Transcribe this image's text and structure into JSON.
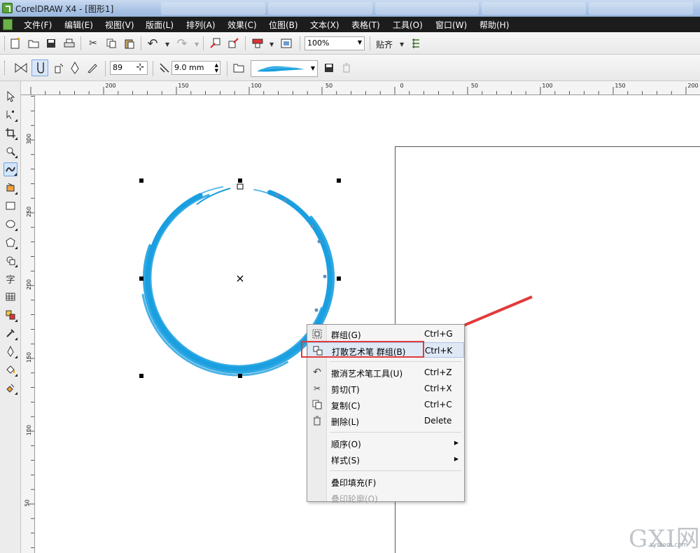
{
  "window": {
    "title": "CorelDRAW X4 - [图形1]"
  },
  "menubar": {
    "items": [
      "文件(F)",
      "编辑(E)",
      "视图(V)",
      "版面(L)",
      "排列(A)",
      "效果(C)",
      "位图(B)",
      "文本(X)",
      "表格(T)",
      "工具(O)",
      "窗口(W)",
      "帮助(H)"
    ]
  },
  "toolbar1": {
    "zoom_value": "100%",
    "snap_label": "贴齐",
    "icons": [
      "new-document-icon",
      "open-folder-icon",
      "save-icon",
      "print-icon",
      "cut-icon",
      "copy-icon",
      "paste-icon",
      "undo-icon",
      "redo-icon",
      "import-icon",
      "export-icon",
      "application-launcher-icon",
      "welcome-screen-icon",
      "options-icon"
    ]
  },
  "toolbar2": {
    "freehand_smoothing": "89",
    "stroke_width": "9.0 mm",
    "icons": [
      "preset-icon",
      "brush-icon",
      "sprayer-icon",
      "calligraphic-icon",
      "pressure-icon",
      "browse-folder-icon",
      "save-stroke-icon",
      "delete-stroke-icon"
    ]
  },
  "ruler": {
    "top_labels": [
      "200",
      "150",
      "100",
      "50",
      "0",
      "50",
      "100",
      "150",
      "200"
    ],
    "left_labels": [
      "300",
      "250",
      "200",
      "150",
      "100",
      "50"
    ]
  },
  "toolbox": {
    "tools": [
      "pick-tool-icon",
      "shape-tool-icon",
      "crop-tool-icon",
      "zoom-tool-icon",
      "artistic-media-tool-icon",
      "smart-fill-tool-icon",
      "rectangle-tool-icon",
      "ellipse-tool-icon",
      "polygon-tool-icon",
      "basic-shapes-tool-icon",
      "text-tool-icon",
      "table-tool-icon",
      "interactive-blend-tool-icon",
      "eyedropper-tool-icon",
      "outline-tool-icon",
      "fill-tool-icon",
      "interactive-fill-tool-icon"
    ],
    "text_tool_glyph": "字",
    "active_tool": "artistic-media-tool-icon"
  },
  "artwork": {
    "stroke_color": "#1a9fe0"
  },
  "context_menu": {
    "items": [
      {
        "label": "群组(G)",
        "shortcut": "Ctrl+G",
        "icon": "group-icon",
        "disabled": false,
        "submenu": false
      },
      {
        "label": "打散艺术笔 群组(B)",
        "shortcut": "Ctrl+K",
        "icon": "break-apart-icon",
        "disabled": false,
        "submenu": false,
        "highlighted": true
      },
      {
        "separator": true
      },
      {
        "label": "撤消艺术笔工具(U)",
        "shortcut": "Ctrl+Z",
        "icon": "undo-icon",
        "disabled": false,
        "submenu": false
      },
      {
        "label": "剪切(T)",
        "shortcut": "Ctrl+X",
        "icon": "cut-icon",
        "disabled": false,
        "submenu": false
      },
      {
        "label": "复制(C)",
        "shortcut": "Ctrl+C",
        "icon": "copy-icon",
        "disabled": false,
        "submenu": false
      },
      {
        "label": "删除(L)",
        "shortcut": "Delete",
        "icon": "delete-icon",
        "disabled": false,
        "submenu": false
      },
      {
        "separator": true
      },
      {
        "label": "顺序(O)",
        "shortcut": "",
        "icon": "",
        "disabled": false,
        "submenu": true
      },
      {
        "label": "样式(S)",
        "shortcut": "",
        "icon": "",
        "disabled": false,
        "submenu": true
      },
      {
        "separator": true
      },
      {
        "label": "叠印填充(F)",
        "shortcut": "",
        "icon": "",
        "disabled": false,
        "submenu": false
      },
      {
        "label": "叠印轮廓(O)",
        "shortcut": "",
        "icon": "",
        "disabled": true,
        "submenu": false
      }
    ]
  },
  "annotation": {
    "color": "#e23a3a"
  },
  "watermark": {
    "big": "GXI网",
    "small": "system.com"
  }
}
